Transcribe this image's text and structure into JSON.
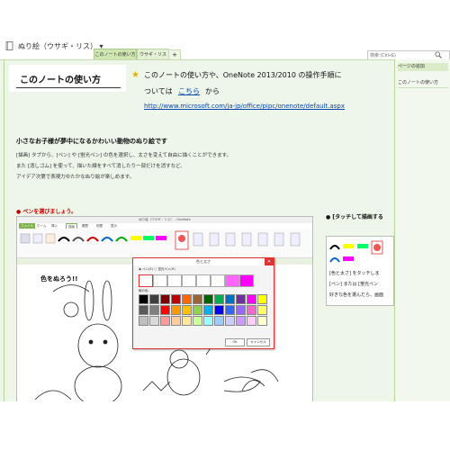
{
  "notebook": {
    "name": "ぬり絵（ウサギ・リス）",
    "dropdown": "▾"
  },
  "tabs": [
    {
      "label": "このノートの使い方"
    },
    {
      "label": "ウサギ・リス"
    },
    {
      "label": "+"
    }
  ],
  "search": {
    "placeholder": "検索 (Ctrl+E)"
  },
  "right_panel": {
    "add_page": "ページの追加",
    "page_item": "このノートの使い方"
  },
  "page": {
    "title": "このノートの使い方",
    "intro_line1": "このノートの使い方や、OneNote 2013/2010 の操作手順に",
    "intro_line2_prefix": "ついては",
    "intro_link": "こちら",
    "intro_line2_suffix": "から",
    "url": "http://www.microsoft.com/ja-jp/office/pipc/onenote/default.aspx",
    "heading2": "小さなお子様が夢中になるかわいい動物のぬり絵です",
    "body_lines": [
      "[描画] タブから、[ペン] や [蛍光ペン] の色を選択し、太さを変えて自由に描くことができます。",
      "また [消しゴム] を使って、描いた線をすべて消したり一部だけを消すなど、",
      "アイデア次第で表現力ゆたかなぬり絵が楽しめます。"
    ],
    "pen_label": "● ペンを選びましょう。",
    "touch_label": "● [タッチして描画する"
  },
  "embedded": {
    "window_title": "ぬり絵（ウサギ・リス） - OneNote",
    "ribbon_tabs": [
      "ファイル",
      "ホーム",
      "挿入",
      "描画",
      "履歴",
      "校閲",
      "表示"
    ],
    "color_heading": "色をぬろう!!",
    "dialog": {
      "title": "色と太さ",
      "radio": "◉ ペン(E)   ○ 蛍光ペン(H)",
      "colors_label": "線の色:",
      "ok": "OK",
      "cancel": "キャンセル"
    }
  },
  "touch": {
    "line1": "[色と太さ] をタッチしま",
    "line2": "[ペン] または [蛍光ペン",
    "line3": "好きな色を選んだら、画面"
  },
  "colors": {
    "accent_green": "#b8d49a",
    "note_bg": "#eef6ea",
    "link": "#0645ad",
    "red_label": "#c00000"
  },
  "palette": [
    "#000000",
    "#3f3f3f",
    "#7f0000",
    "#c00000",
    "#ff6600",
    "#996633",
    "#006600",
    "#00b050",
    "#0070c0",
    "#7030a0",
    "#ff00ff",
    "#ffff00",
    "#595959",
    "#7f7f7f",
    "#ff0000",
    "#ff9900",
    "#ffc000",
    "#92d050",
    "#00b0f0",
    "#0000ff",
    "#3366ff",
    "#9966ff",
    "#ff66cc",
    "#ffff66",
    "#bfbfbf",
    "#d9d9d9",
    "#ff9999",
    "#ffcc99",
    "#ffe699",
    "#ccff99",
    "#99ffff",
    "#99ccff",
    "#ccccff",
    "#cc99ff",
    "#ffccff",
    "#ffffcc"
  ]
}
